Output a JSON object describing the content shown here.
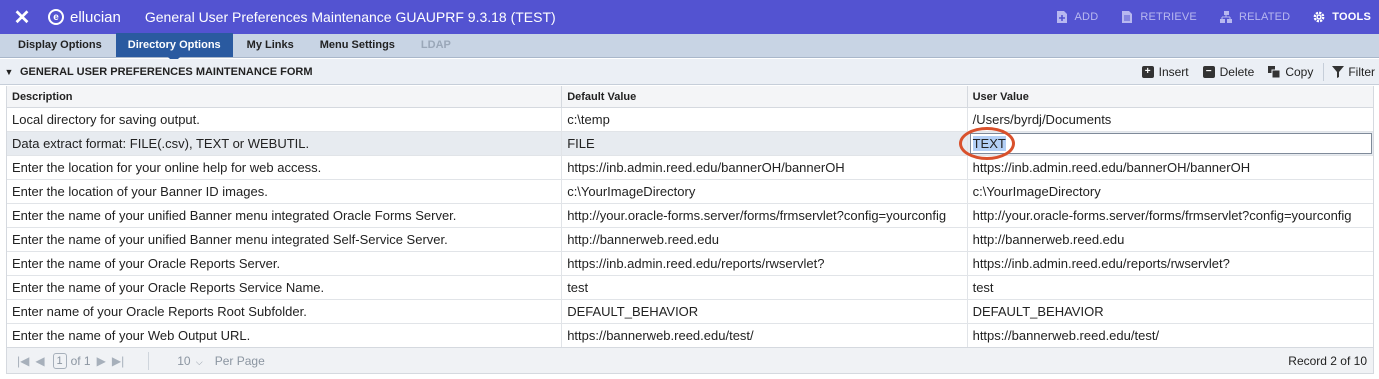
{
  "titlebar": {
    "close_icon": "close-icon",
    "brand": "ellucian",
    "title": "General User Preferences Maintenance GUAUPRF 9.3.18 (TEST)",
    "actions": [
      {
        "label": "ADD",
        "icon": "add-icon"
      },
      {
        "label": "RETRIEVE",
        "icon": "retrieve-icon"
      },
      {
        "label": "RELATED",
        "icon": "related-icon"
      },
      {
        "label": "TOOLS",
        "icon": "gear-icon"
      }
    ],
    "colors": {
      "bar": "#5353d1",
      "muted_action": "#b8b8f0"
    }
  },
  "tabs": [
    {
      "label": "Display Options",
      "state": "normal"
    },
    {
      "label": "Directory Options",
      "state": "active"
    },
    {
      "label": "My Links",
      "state": "normal"
    },
    {
      "label": "Menu Settings",
      "state": "normal"
    },
    {
      "label": "LDAP",
      "state": "disabled"
    }
  ],
  "section": {
    "title": "GENERAL USER PREFERENCES MAINTENANCE FORM",
    "tools": [
      {
        "label": "Insert",
        "icon": "plus-icon"
      },
      {
        "label": "Delete",
        "icon": "minus-icon"
      },
      {
        "label": "Copy",
        "icon": "copy-icon"
      },
      {
        "label": "Filter",
        "icon": "filter-icon"
      }
    ]
  },
  "grid": {
    "columns": [
      "Description",
      "Default Value",
      "User Value"
    ],
    "rows": [
      [
        "Local directory for saving output.",
        "c:\\temp",
        "/Users/byrdj/Documents"
      ],
      [
        "Data extract format: FILE(.csv), TEXT or WEBUTIL.",
        "FILE",
        "TEXT"
      ],
      [
        "Enter the location for your online help for web access.",
        "https://inb.admin.reed.edu/bannerOH/bannerOH",
        "https://inb.admin.reed.edu/bannerOH/bannerOH"
      ],
      [
        "Enter the location of your Banner ID images.",
        "c:\\YourImageDirectory",
        "c:\\YourImageDirectory"
      ],
      [
        "Enter the name of your unified Banner menu integrated Oracle Forms Server.",
        "http://your.oracle-forms.server/forms/frmservlet?config=yourconfig",
        "http://your.oracle-forms.server/forms/frmservlet?config=yourconfig"
      ],
      [
        "Enter the name of your unified Banner menu integrated Self-Service Server.",
        "http://bannerweb.reed.edu",
        "http://bannerweb.reed.edu"
      ],
      [
        "Enter the name of your Oracle Reports Server.",
        "https://inb.admin.reed.edu/reports/rwservlet?",
        "https://inb.admin.reed.edu/reports/rwservlet?"
      ],
      [
        "Enter the name of your Oracle Reports Service Name.",
        "test",
        "test"
      ],
      [
        "Enter name of your Oracle Reports Root Subfolder.",
        "DEFAULT_BEHAVIOR",
        "DEFAULT_BEHAVIOR"
      ],
      [
        "Enter the name of your Web Output URL.",
        "https://bannerweb.reed.edu/test/",
        "https://bannerweb.reed.edu/test/"
      ]
    ],
    "selected_row": 1,
    "annotation_color": "#d9512c"
  },
  "pager": {
    "page": "1",
    "of": "of 1",
    "page_size": "10",
    "per_page": "Per Page",
    "record": "Record 2 of 10"
  }
}
